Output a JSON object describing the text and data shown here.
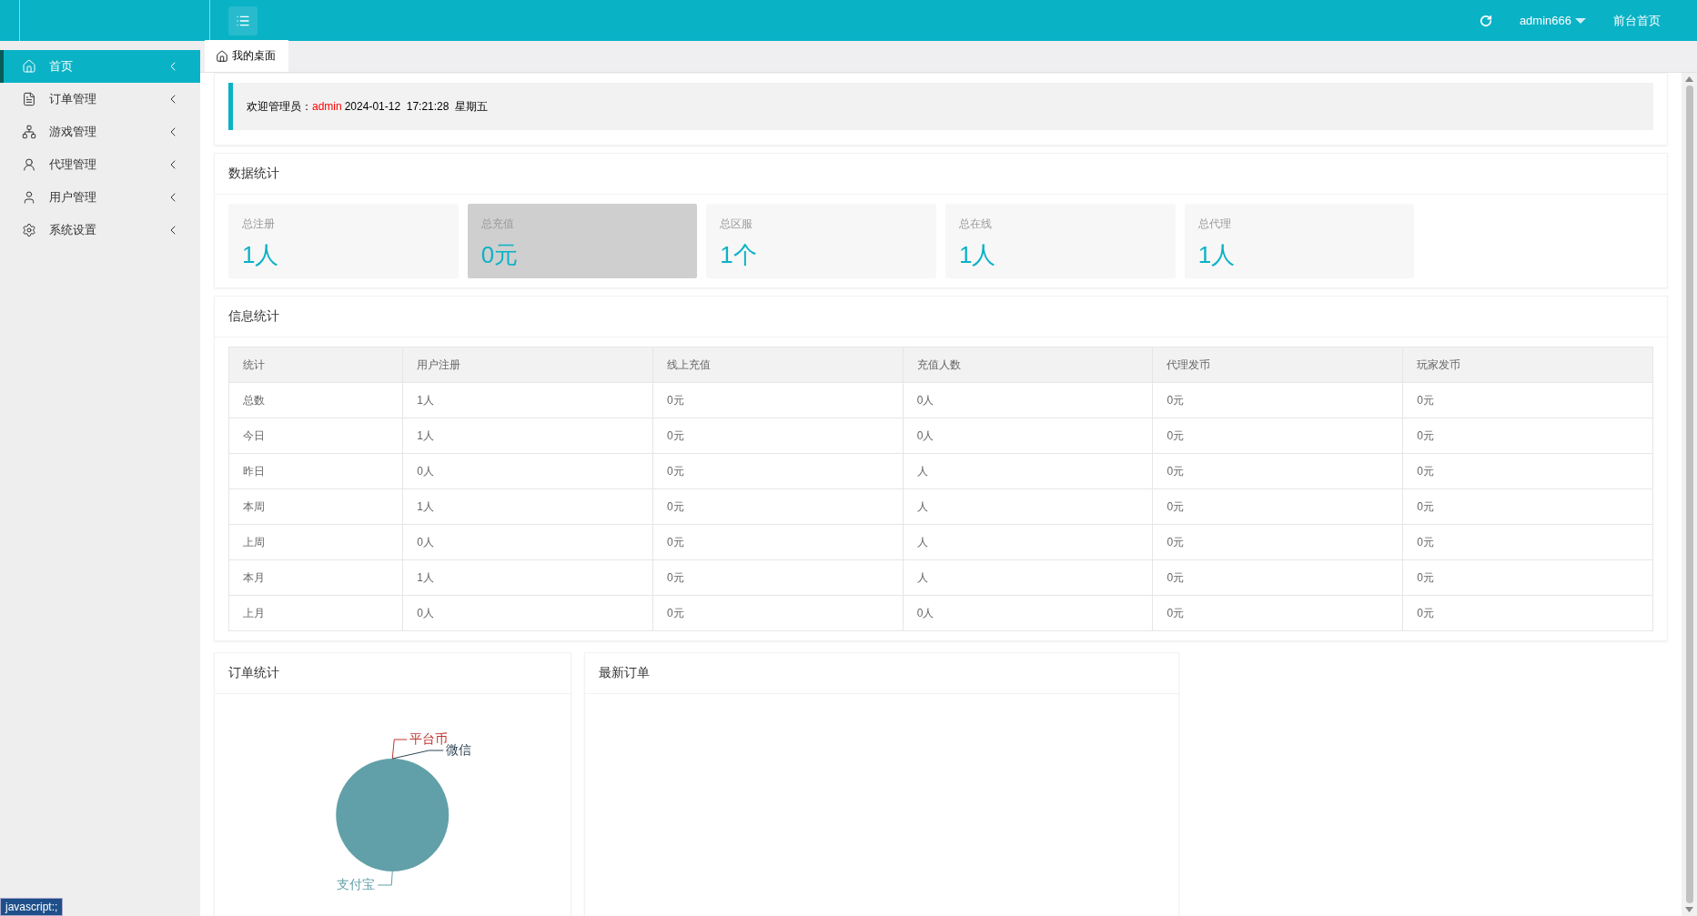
{
  "header": {
    "user": "admin666",
    "front_link": "前台首页"
  },
  "sidebar": {
    "items": [
      {
        "label": "首页",
        "selected": true
      },
      {
        "label": "订单管理",
        "selected": false
      },
      {
        "label": "游戏管理",
        "selected": false
      },
      {
        "label": "代理管理",
        "selected": false
      },
      {
        "label": "用户管理",
        "selected": false
      },
      {
        "label": "系统设置",
        "selected": false
      }
    ]
  },
  "tabs": [
    {
      "label": "我的桌面",
      "selected": true
    }
  ],
  "welcome": {
    "greeting": "欢迎管理员：",
    "user": "admin",
    "datetime": "2024-01-12  17:21:28  星期五"
  },
  "data_stats": {
    "title": "数据统计",
    "cards": [
      {
        "label": "总注册",
        "value": "1人",
        "highlighted": false
      },
      {
        "label": "总充值",
        "value": "0元",
        "highlighted": true
      },
      {
        "label": "总区服",
        "value": "1个",
        "highlighted": false
      },
      {
        "label": "总在线",
        "value": "1人",
        "highlighted": false
      },
      {
        "label": "总代理",
        "value": "1人",
        "highlighted": false
      }
    ]
  },
  "info_stats": {
    "title": "信息统计",
    "columns": [
      "统计",
      "用户注册",
      "线上充值",
      "充值人数",
      "代理发币",
      "玩家发币"
    ],
    "rows": [
      [
        "总数",
        "1人",
        "0元",
        "0人",
        "0元",
        "0元"
      ],
      [
        "今日",
        "1人",
        "0元",
        "0人",
        "0元",
        "0元"
      ],
      [
        "昨日",
        "0人",
        "0元",
        "人",
        "0元",
        "0元"
      ],
      [
        "本周",
        "1人",
        "0元",
        "人",
        "0元",
        "0元"
      ],
      [
        "上周",
        "0人",
        "0元",
        "人",
        "0元",
        "0元"
      ],
      [
        "本月",
        "1人",
        "0元",
        "人",
        "0元",
        "0元"
      ],
      [
        "上月",
        "0人",
        "0元",
        "0人",
        "0元",
        "0元"
      ]
    ]
  },
  "order_stats": {
    "title": "订单统计",
    "pie_labels": [
      {
        "label": "平台币",
        "color": "#c23531"
      },
      {
        "label": "微信",
        "color": "#2f4554"
      },
      {
        "label": "支付宝",
        "color": "#61a0a8"
      }
    ]
  },
  "latest_orders": {
    "title": "最新订单"
  },
  "status_bar": "javascript:;"
}
